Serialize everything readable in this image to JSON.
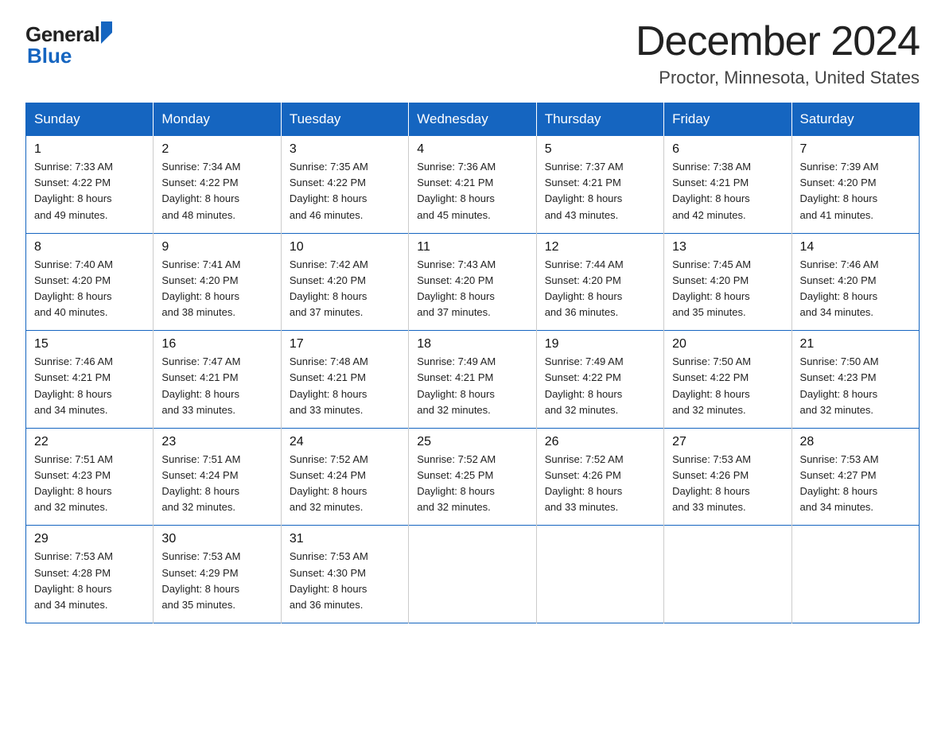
{
  "logo": {
    "general": "General",
    "blue": "Blue"
  },
  "title": "December 2024",
  "location": "Proctor, Minnesota, United States",
  "days_of_week": [
    "Sunday",
    "Monday",
    "Tuesday",
    "Wednesday",
    "Thursday",
    "Friday",
    "Saturday"
  ],
  "weeks": [
    [
      {
        "day": "1",
        "sunrise": "7:33 AM",
        "sunset": "4:22 PM",
        "daylight": "8 hours and 49 minutes."
      },
      {
        "day": "2",
        "sunrise": "7:34 AM",
        "sunset": "4:22 PM",
        "daylight": "8 hours and 48 minutes."
      },
      {
        "day": "3",
        "sunrise": "7:35 AM",
        "sunset": "4:22 PM",
        "daylight": "8 hours and 46 minutes."
      },
      {
        "day": "4",
        "sunrise": "7:36 AM",
        "sunset": "4:21 PM",
        "daylight": "8 hours and 45 minutes."
      },
      {
        "day": "5",
        "sunrise": "7:37 AM",
        "sunset": "4:21 PM",
        "daylight": "8 hours and 43 minutes."
      },
      {
        "day": "6",
        "sunrise": "7:38 AM",
        "sunset": "4:21 PM",
        "daylight": "8 hours and 42 minutes."
      },
      {
        "day": "7",
        "sunrise": "7:39 AM",
        "sunset": "4:20 PM",
        "daylight": "8 hours and 41 minutes."
      }
    ],
    [
      {
        "day": "8",
        "sunrise": "7:40 AM",
        "sunset": "4:20 PM",
        "daylight": "8 hours and 40 minutes."
      },
      {
        "day": "9",
        "sunrise": "7:41 AM",
        "sunset": "4:20 PM",
        "daylight": "8 hours and 38 minutes."
      },
      {
        "day": "10",
        "sunrise": "7:42 AM",
        "sunset": "4:20 PM",
        "daylight": "8 hours and 37 minutes."
      },
      {
        "day": "11",
        "sunrise": "7:43 AM",
        "sunset": "4:20 PM",
        "daylight": "8 hours and 37 minutes."
      },
      {
        "day": "12",
        "sunrise": "7:44 AM",
        "sunset": "4:20 PM",
        "daylight": "8 hours and 36 minutes."
      },
      {
        "day": "13",
        "sunrise": "7:45 AM",
        "sunset": "4:20 PM",
        "daylight": "8 hours and 35 minutes."
      },
      {
        "day": "14",
        "sunrise": "7:46 AM",
        "sunset": "4:20 PM",
        "daylight": "8 hours and 34 minutes."
      }
    ],
    [
      {
        "day": "15",
        "sunrise": "7:46 AM",
        "sunset": "4:21 PM",
        "daylight": "8 hours and 34 minutes."
      },
      {
        "day": "16",
        "sunrise": "7:47 AM",
        "sunset": "4:21 PM",
        "daylight": "8 hours and 33 minutes."
      },
      {
        "day": "17",
        "sunrise": "7:48 AM",
        "sunset": "4:21 PM",
        "daylight": "8 hours and 33 minutes."
      },
      {
        "day": "18",
        "sunrise": "7:49 AM",
        "sunset": "4:21 PM",
        "daylight": "8 hours and 32 minutes."
      },
      {
        "day": "19",
        "sunrise": "7:49 AM",
        "sunset": "4:22 PM",
        "daylight": "8 hours and 32 minutes."
      },
      {
        "day": "20",
        "sunrise": "7:50 AM",
        "sunset": "4:22 PM",
        "daylight": "8 hours and 32 minutes."
      },
      {
        "day": "21",
        "sunrise": "7:50 AM",
        "sunset": "4:23 PM",
        "daylight": "8 hours and 32 minutes."
      }
    ],
    [
      {
        "day": "22",
        "sunrise": "7:51 AM",
        "sunset": "4:23 PM",
        "daylight": "8 hours and 32 minutes."
      },
      {
        "day": "23",
        "sunrise": "7:51 AM",
        "sunset": "4:24 PM",
        "daylight": "8 hours and 32 minutes."
      },
      {
        "day": "24",
        "sunrise": "7:52 AM",
        "sunset": "4:24 PM",
        "daylight": "8 hours and 32 minutes."
      },
      {
        "day": "25",
        "sunrise": "7:52 AM",
        "sunset": "4:25 PM",
        "daylight": "8 hours and 32 minutes."
      },
      {
        "day": "26",
        "sunrise": "7:52 AM",
        "sunset": "4:26 PM",
        "daylight": "8 hours and 33 minutes."
      },
      {
        "day": "27",
        "sunrise": "7:53 AM",
        "sunset": "4:26 PM",
        "daylight": "8 hours and 33 minutes."
      },
      {
        "day": "28",
        "sunrise": "7:53 AM",
        "sunset": "4:27 PM",
        "daylight": "8 hours and 34 minutes."
      }
    ],
    [
      {
        "day": "29",
        "sunrise": "7:53 AM",
        "sunset": "4:28 PM",
        "daylight": "8 hours and 34 minutes."
      },
      {
        "day": "30",
        "sunrise": "7:53 AM",
        "sunset": "4:29 PM",
        "daylight": "8 hours and 35 minutes."
      },
      {
        "day": "31",
        "sunrise": "7:53 AM",
        "sunset": "4:30 PM",
        "daylight": "8 hours and 36 minutes."
      },
      null,
      null,
      null,
      null
    ]
  ],
  "labels": {
    "sunrise": "Sunrise:",
    "sunset": "Sunset:",
    "daylight": "Daylight:"
  }
}
